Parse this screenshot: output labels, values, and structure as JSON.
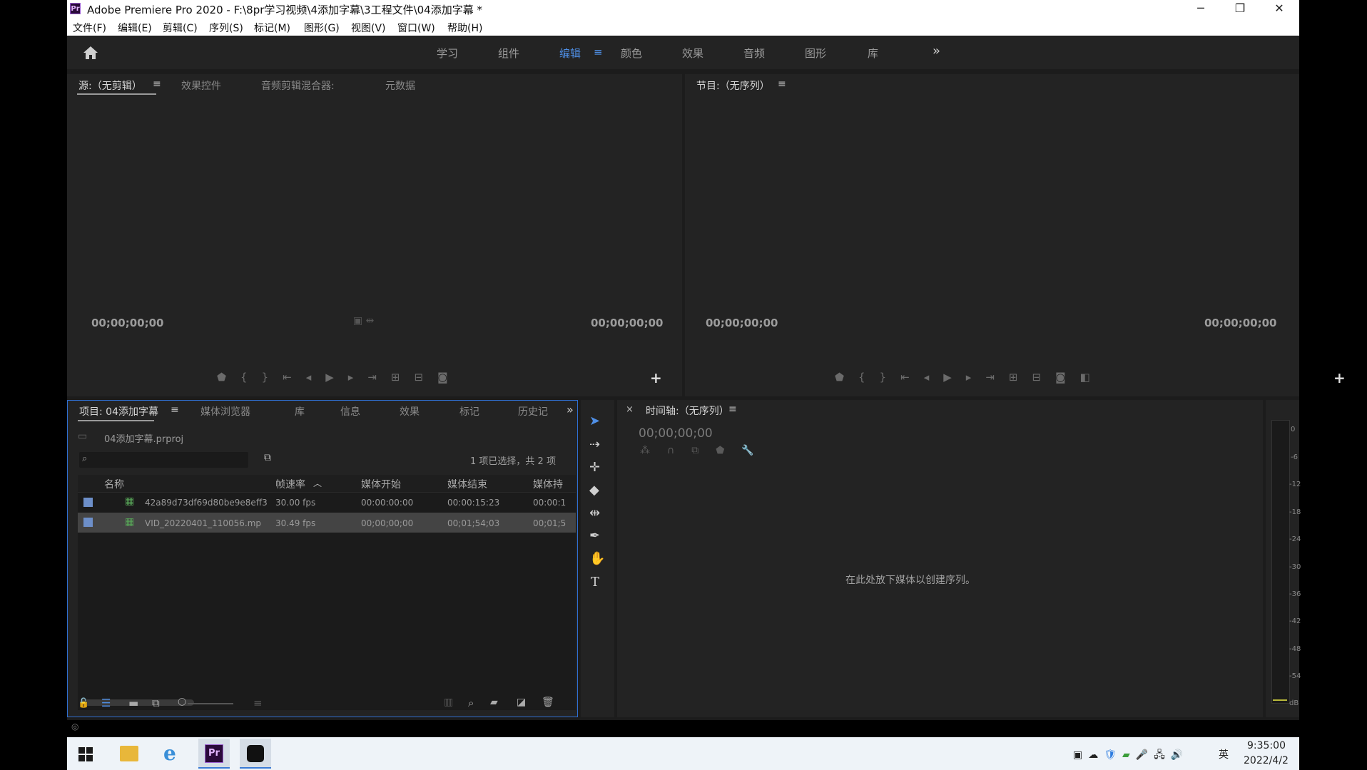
{
  "window": {
    "title": "Adobe Premiere Pro 2020 - F:\\8pr学习视频\\4添加字幕\\3工程文件\\04添加字幕 *",
    "app_icon": "Pr",
    "buttons": {
      "minimize": "─",
      "restore": "❐",
      "close": "✕"
    }
  },
  "menu": [
    "文件(F)",
    "编辑(E)",
    "剪辑(C)",
    "序列(S)",
    "标记(M)",
    "图形(G)",
    "视图(V)",
    "窗口(W)",
    "帮助(H)"
  ],
  "workspaces": {
    "items": [
      "学习",
      "组件",
      "编辑",
      "颜色",
      "效果",
      "音频",
      "图形",
      "库"
    ],
    "active": "编辑",
    "more": "»"
  },
  "source_panel": {
    "tabs": [
      "源:（无剪辑）",
      "效果控件",
      "音频剪辑混合器:",
      "元数据"
    ],
    "timecode_in": "00;00;00;00",
    "timecode_out": "00;00;00;00"
  },
  "program_panel": {
    "tab": "节目:（无序列）",
    "timecode_in": "00;00;00;00",
    "timecode_out": "00;00;00;00"
  },
  "project_panel": {
    "tabs": [
      "项目: 04添加字幕",
      "媒体浏览器",
      "库",
      "信息",
      "效果",
      "标记",
      "历史记"
    ],
    "project_file": "04添加字幕.prproj",
    "selection_status": "1 项已选择，共 2 项",
    "columns": [
      "名称",
      "帧速率",
      "媒体开始",
      "媒体结束",
      "媒体持"
    ],
    "rows": [
      {
        "name": "42a89d73df69d80be9e8eff3",
        "fps": "30.00 fps",
        "start": "00:00:00:00",
        "end": "00:00:15:23",
        "dur": "00:00:1"
      },
      {
        "name": "VID_20220401_110056.mp",
        "fps": "30.49 fps",
        "start": "00;00;00;00",
        "end": "00;01;54;03",
        "dur": "00;01;5"
      }
    ],
    "label_color": "#6d8fc9"
  },
  "timeline_panel": {
    "tab": "时间轴:（无序列）",
    "close": "×",
    "timecode": "00;00;00;00",
    "empty_message": "在此处放下媒体以创建序列。"
  },
  "audio_meter": {
    "labels": [
      "0",
      "-6",
      "-12",
      "-18",
      "-24",
      "-30",
      "-36",
      "-42",
      "-48",
      "-54",
      "dB"
    ]
  },
  "tools": [
    "selection-tool",
    "track-select-tool",
    "ripple-edit-tool",
    "razor-tool",
    "slip-tool",
    "pen-tool",
    "hand-tool",
    "type-tool"
  ],
  "taskbar": {
    "time": "9:35:00",
    "date": "2022/4/2",
    "ime": "英"
  },
  "colors": {
    "accent": "#4f8fe6",
    "panel_bg": "#232323",
    "premiere": "#2a0a3a"
  }
}
